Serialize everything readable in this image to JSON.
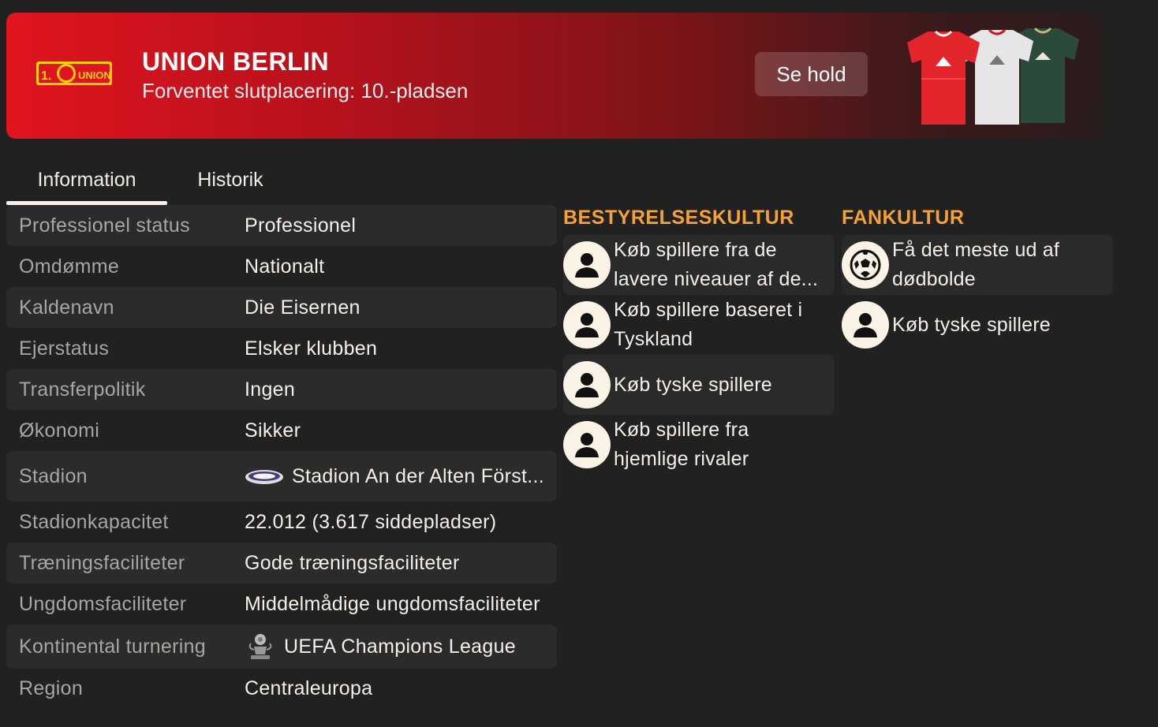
{
  "header": {
    "club_name": "UNION BERLIN",
    "expected_finish": "Forventet slutplacering: 10.-pladsen",
    "view_squad_button": "Se hold",
    "logo_text": "UNION",
    "accent_color": "#e0141f"
  },
  "tabs": [
    {
      "label": "Information",
      "active": true
    },
    {
      "label": "Historik",
      "active": false
    }
  ],
  "info": {
    "rows": [
      {
        "key": "Professionel status",
        "value": "Professionel"
      },
      {
        "key": "Omdømme",
        "value": "Nationalt"
      },
      {
        "key": "Kaldenavn",
        "value": "Die Eisernen"
      },
      {
        "key": "Ejerstatus",
        "value": "Elsker klubben"
      },
      {
        "key": "Transferpolitik",
        "value": "Ingen"
      },
      {
        "key": "Økonomi",
        "value": "Sikker"
      },
      {
        "key": "Stadion",
        "value": "Stadion An der Alten Först...",
        "icon": "stadium-icon"
      },
      {
        "key": "Stadionkapacitet",
        "value": "22.012 (3.617 siddepladser)"
      },
      {
        "key": "Træningsfaciliteter",
        "value": "Gode træningsfaciliteter"
      },
      {
        "key": "Ungdomsfaciliteter",
        "value": "Middelmådige ungdomsfaciliteter"
      },
      {
        "key": "Kontinental turnering",
        "value": "UEFA Champions League",
        "icon": "champions-league-icon"
      },
      {
        "key": "Region",
        "value": "Centraleuropa"
      }
    ]
  },
  "board_culture": {
    "title": "BESTYRELSESKULTUR",
    "items": [
      {
        "text": "Køb spillere fra de lavere niveauer af de...",
        "icon": "person-icon"
      },
      {
        "text": "Køb spillere baseret i Tyskland",
        "icon": "person-icon"
      },
      {
        "text": "Køb tyske spillere",
        "icon": "person-icon"
      },
      {
        "text": "Køb spillere fra hjemlige rivaler",
        "icon": "person-icon"
      }
    ]
  },
  "fan_culture": {
    "title": "FANKULTUR",
    "items": [
      {
        "text": "Få det meste ud af dødbolde",
        "icon": "football-icon"
      },
      {
        "text": "Køb tyske spillere",
        "icon": "person-icon"
      }
    ]
  }
}
